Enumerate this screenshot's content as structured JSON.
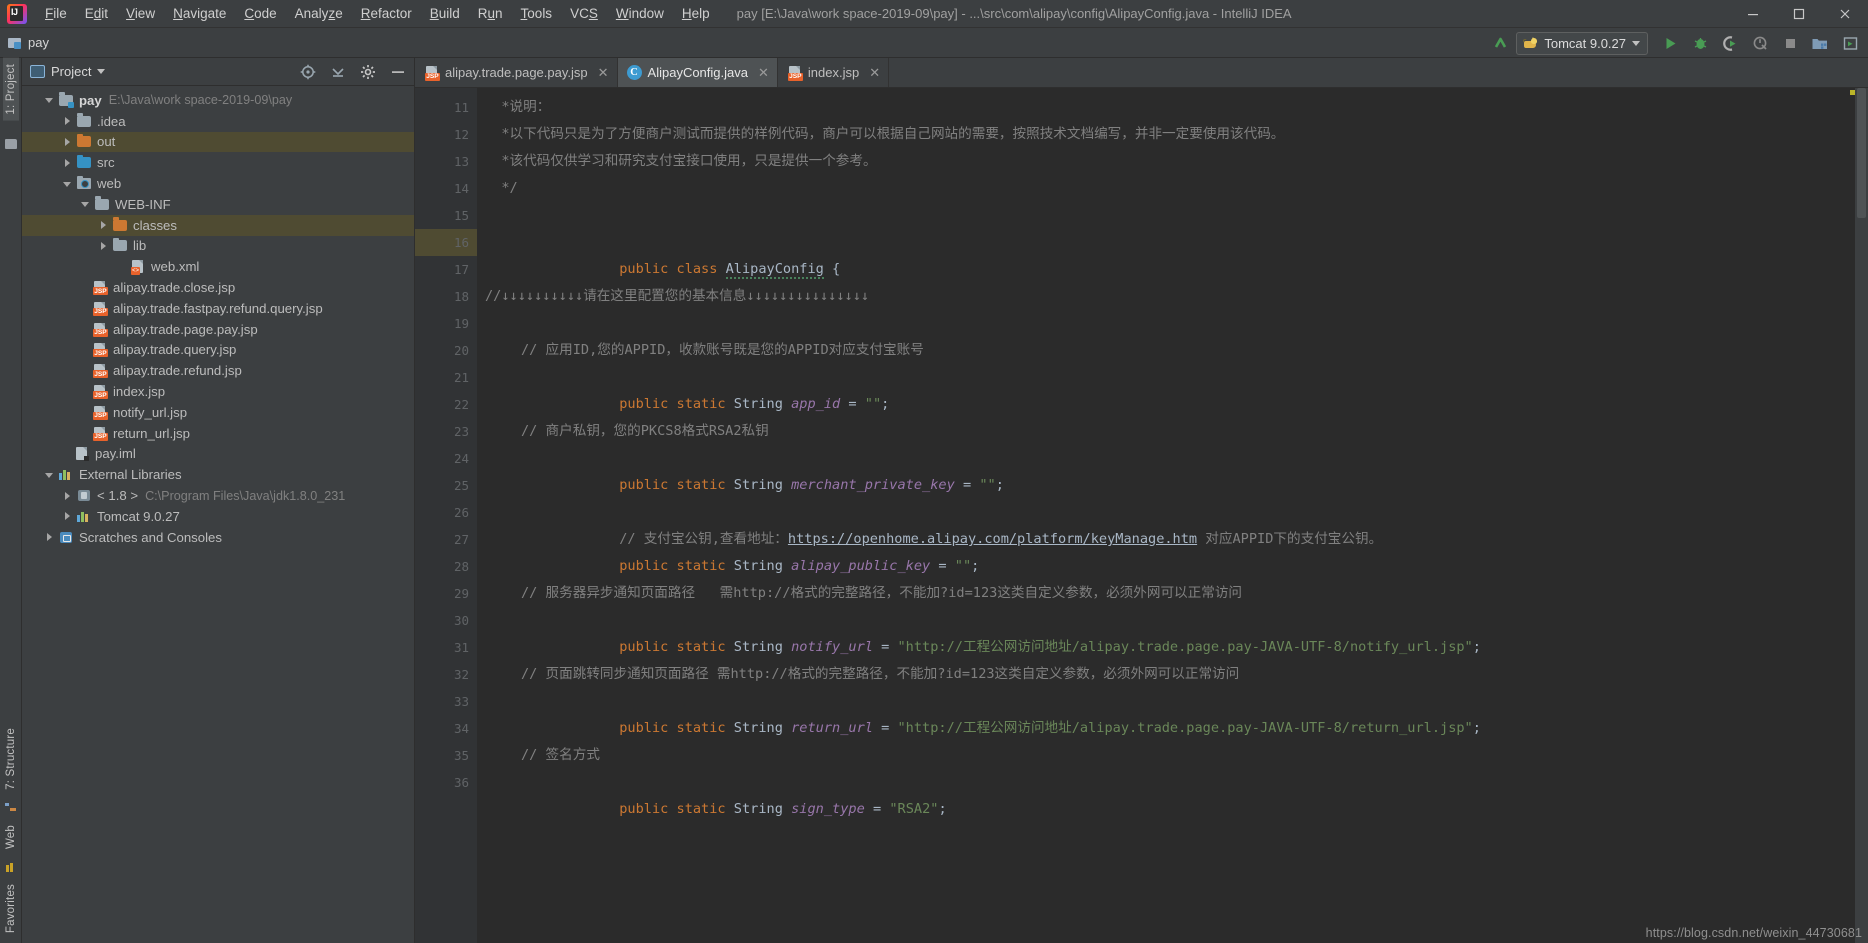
{
  "window": {
    "title": "pay [E:\\Java\\work space-2019-09\\pay] - ...\\src\\com\\alipay\\config\\AlipayConfig.java - IntelliJ IDEA",
    "minimize_label": "minimize-icon",
    "maximize_label": "maximize-icon",
    "close_label": "close-icon"
  },
  "menu": {
    "items": [
      {
        "label": "File"
      },
      {
        "label": "Edit"
      },
      {
        "label": "View"
      },
      {
        "label": "Navigate"
      },
      {
        "label": "Code"
      },
      {
        "label": "Analyze"
      },
      {
        "label": "Refactor"
      },
      {
        "label": "Build"
      },
      {
        "label": "Run"
      },
      {
        "label": "Tools"
      },
      {
        "label": "VCS"
      },
      {
        "label": "Window"
      },
      {
        "label": "Help"
      }
    ]
  },
  "toolbar": {
    "breadcrumb": "pay",
    "run_config": "Tomcat 9.0.27",
    "icons": [
      "update-project-icon",
      "run-icon",
      "debug-icon",
      "run-coverage-icon",
      "profile-icon",
      "stop-icon",
      "build-project-icon",
      "open-browser-icon"
    ]
  },
  "rail": {
    "left_top": "1: Project",
    "left_items": [
      "7: Structure",
      "Web",
      "Favorites"
    ]
  },
  "project_panel": {
    "title": "Project",
    "header_icons": [
      "locate-icon",
      "collapse-all-icon",
      "settings-gear-icon",
      "hide-icon"
    ],
    "tree": [
      {
        "label": "pay",
        "sub": "E:\\Java\\work space-2019-09\\pay",
        "indent": 0,
        "arrow": "down",
        "icon": "module-folder",
        "bold": true,
        "hl": false
      },
      {
        "label": ".idea",
        "sub": "",
        "indent": 1,
        "arrow": "right",
        "icon": "folder-gray",
        "bold": false,
        "hl": false
      },
      {
        "label": "out",
        "sub": "",
        "indent": 1,
        "arrow": "right",
        "icon": "folder-orange",
        "bold": false,
        "hl": true
      },
      {
        "label": "src",
        "sub": "",
        "indent": 1,
        "arrow": "right",
        "icon": "folder-blue",
        "bold": false,
        "hl": false
      },
      {
        "label": "web",
        "sub": "",
        "indent": 1,
        "arrow": "down",
        "icon": "folder-web",
        "bold": false,
        "hl": false
      },
      {
        "label": "WEB-INF",
        "sub": "",
        "indent": 2,
        "arrow": "down",
        "icon": "folder-gray",
        "bold": false,
        "hl": false
      },
      {
        "label": "classes",
        "sub": "",
        "indent": 3,
        "arrow": "right",
        "icon": "folder-orange",
        "bold": false,
        "hl": true
      },
      {
        "label": "lib",
        "sub": "",
        "indent": 3,
        "arrow": "right",
        "icon": "folder-gray",
        "bold": false,
        "hl": false
      },
      {
        "label": "web.xml",
        "sub": "",
        "indent": 4,
        "arrow": "none",
        "icon": "file-xml",
        "bold": false,
        "hl": false
      },
      {
        "label": "alipay.trade.close.jsp",
        "sub": "",
        "indent": 3,
        "arrow": "none",
        "icon": "file-jsp",
        "bold": false,
        "hl": false
      },
      {
        "label": "alipay.trade.fastpay.refund.query.jsp",
        "sub": "",
        "indent": 3,
        "arrow": "none",
        "icon": "file-jsp",
        "bold": false,
        "hl": false
      },
      {
        "label": "alipay.trade.page.pay.jsp",
        "sub": "",
        "indent": 3,
        "arrow": "none",
        "icon": "file-jsp",
        "bold": false,
        "hl": false
      },
      {
        "label": "alipay.trade.query.jsp",
        "sub": "",
        "indent": 3,
        "arrow": "none",
        "icon": "file-jsp",
        "bold": false,
        "hl": false
      },
      {
        "label": "alipay.trade.refund.jsp",
        "sub": "",
        "indent": 3,
        "arrow": "none",
        "icon": "file-jsp",
        "bold": false,
        "hl": false
      },
      {
        "label": "index.jsp",
        "sub": "",
        "indent": 3,
        "arrow": "none",
        "icon": "file-jsp",
        "bold": false,
        "hl": false
      },
      {
        "label": "notify_url.jsp",
        "sub": "",
        "indent": 3,
        "arrow": "none",
        "icon": "file-jsp",
        "bold": false,
        "hl": false
      },
      {
        "label": "return_url.jsp",
        "sub": "",
        "indent": 3,
        "arrow": "none",
        "icon": "file-jsp",
        "bold": false,
        "hl": false
      },
      {
        "label": "pay.iml",
        "sub": "",
        "indent": 2,
        "arrow": "none",
        "icon": "file-iml",
        "bold": false,
        "hl": false
      },
      {
        "label": "External Libraries",
        "sub": "",
        "indent": 0,
        "arrow": "down",
        "icon": "libraries",
        "bold": false,
        "hl": false
      },
      {
        "label": "< 1.8 >",
        "sub": "C:\\Program Files\\Java\\jdk1.8.0_231",
        "indent": 1,
        "arrow": "right",
        "icon": "jdk",
        "bold": false,
        "hl": false
      },
      {
        "label": "Tomcat 9.0.27",
        "sub": "",
        "indent": 1,
        "arrow": "right",
        "icon": "libraries",
        "bold": false,
        "hl": false
      },
      {
        "label": "Scratches and Consoles",
        "sub": "",
        "indent": 0,
        "arrow": "right",
        "icon": "scratches",
        "bold": false,
        "hl": false
      }
    ]
  },
  "editor": {
    "tabs": [
      {
        "label": "alipay.trade.page.pay.jsp",
        "icon": "file-jsp",
        "active": false
      },
      {
        "label": "AlipayConfig.java",
        "icon": "java-class",
        "active": true
      },
      {
        "label": "index.jsp",
        "icon": "file-jsp",
        "active": false
      }
    ],
    "first_line_number": 11,
    "lines": [
      {
        "n": 11,
        "fold": false,
        "hl": false
      },
      {
        "n": 12,
        "fold": false,
        "hl": false
      },
      {
        "n": 13,
        "fold": false,
        "hl": false
      },
      {
        "n": 14,
        "fold": true,
        "hl": false
      },
      {
        "n": 15,
        "fold": false,
        "hl": false
      },
      {
        "n": 16,
        "fold": false,
        "hl": true
      },
      {
        "n": 17,
        "fold": false,
        "hl": false
      },
      {
        "n": 18,
        "fold": false,
        "hl": false
      },
      {
        "n": 19,
        "fold": false,
        "hl": false
      },
      {
        "n": 20,
        "fold": false,
        "hl": false
      },
      {
        "n": 21,
        "fold": false,
        "hl": false
      },
      {
        "n": 22,
        "fold": false,
        "hl": false
      },
      {
        "n": 23,
        "fold": false,
        "hl": false
      },
      {
        "n": 24,
        "fold": false,
        "hl": false
      },
      {
        "n": 25,
        "fold": false,
        "hl": false
      },
      {
        "n": 26,
        "fold": false,
        "hl": false
      },
      {
        "n": 27,
        "fold": false,
        "hl": false
      },
      {
        "n": 28,
        "fold": false,
        "hl": false
      },
      {
        "n": 29,
        "fold": false,
        "hl": false
      },
      {
        "n": 30,
        "fold": false,
        "hl": false
      },
      {
        "n": 31,
        "fold": false,
        "hl": false
      },
      {
        "n": 32,
        "fold": false,
        "hl": false
      },
      {
        "n": 33,
        "fold": false,
        "hl": false
      },
      {
        "n": 34,
        "fold": false,
        "hl": false
      },
      {
        "n": 35,
        "fold": false,
        "hl": false
      },
      {
        "n": 36,
        "fold": false,
        "hl": false
      }
    ],
    "code": {
      "l11": "  *说明：",
      "l12": "  *以下代码只是为了方便商户测试而提供的样例代码，商户可以根据自己网站的需要，按照技术文档编写，并非一定要使用该代码。",
      "l13": "  *该代码仅供学习和研究支付宝接口使用，只是提供一个参考。",
      "l14": "  */",
      "l15": "",
      "l16_kw": "public class ",
      "l16_cls": "AlipayConfig",
      "l16_tail": " {",
      "l17": "",
      "l18": "//↓↓↓↓↓↓↓↓↓↓请在这里配置您的基本信息↓↓↓↓↓↓↓↓↓↓↓↓↓↓↓",
      "l19": "",
      "l20": "// 应用ID,您的APPID，收款账号既是您的APPID对应支付宝账号",
      "l21_kw": "public static ",
      "l21_type": "String ",
      "l21_name": "app_id",
      "l21_eq": " = ",
      "l21_val": "\"\"",
      "l21_end": ";",
      "l22": "",
      "l23": "// 商户私钥，您的PKCS8格式RSA2私钥",
      "l24_name": "merchant_private_key",
      "l25": "",
      "l26_a": "// 支付宝公钥,查看地址：",
      "l26_url": "https://openhome.alipay.com/platform/keyManage.htm",
      "l26_b": " 对应APPID下的支付宝公钥。",
      "l27_name": "alipay_public_key",
      "l28": "",
      "l29": "// 服务器异步通知页面路径   需http://格式的完整路径，不能加?id=123这类自定义参数，必须外网可以正常访问",
      "l30_name": "notify_url",
      "l30_val": "\"http://工程公网访问地址/alipay.trade.page.pay-JAVA-UTF-8/notify_url.jsp\"",
      "l31": "",
      "l32": "// 页面跳转同步通知页面路径 需http://格式的完整路径，不能加?id=123这类自定义参数，必须外网可以正常访问",
      "l33_name": "return_url",
      "l33_val": "\"http://工程公网访问地址/alipay.trade.page.pay-JAVA-UTF-8/return_url.jsp\"",
      "l34": "",
      "l35": "// 签名方式",
      "l36_name": "sign_type",
      "l36_val": "\"RSA2\""
    }
  },
  "watermark": "https://blog.csdn.net/weixin_44730681",
  "colors": {
    "bg_panel": "#3c3f41",
    "bg_editor": "#2b2b2b",
    "keyword": "#cc7832",
    "string": "#6a8759",
    "field": "#9876aa",
    "comment": "#808080",
    "plain": "#a9b7c6",
    "highlight_row": "#4f4b32",
    "accent_green": "#499c54"
  }
}
